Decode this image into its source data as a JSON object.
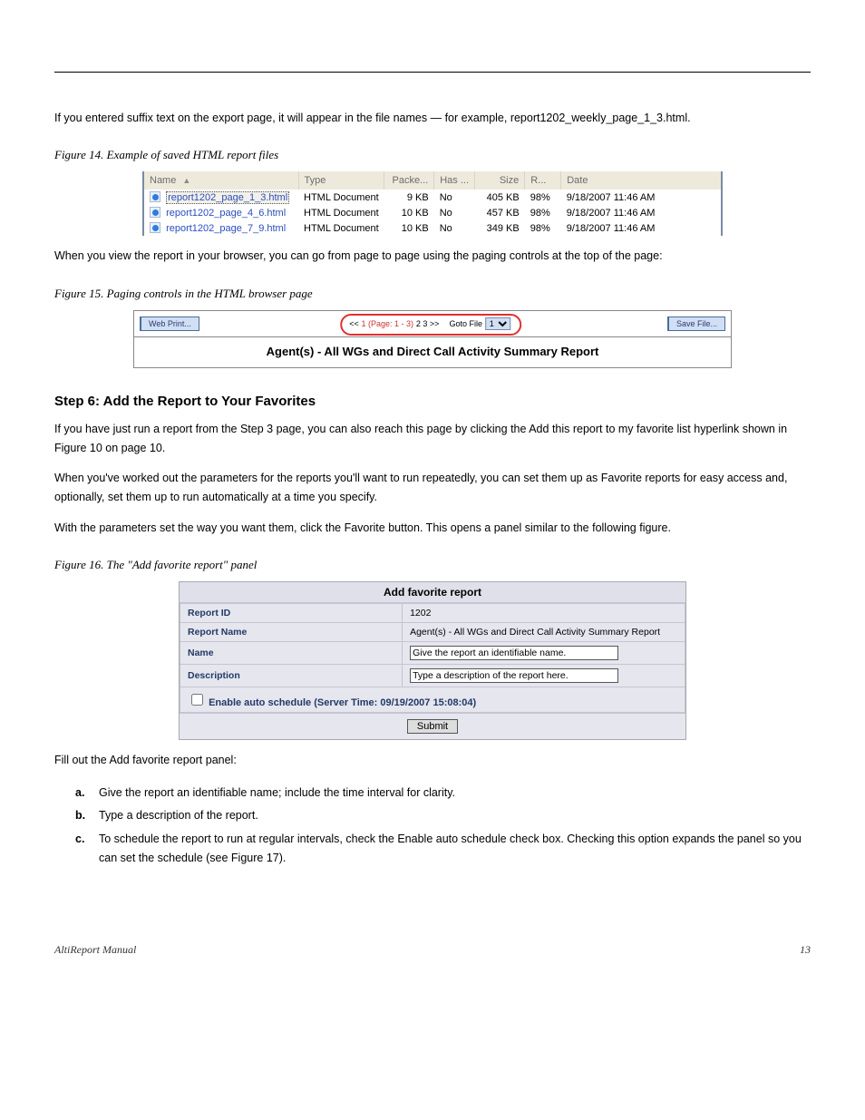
{
  "header_spacer": "",
  "para_intro": "If you entered suffix text on the export page, it will appear in the file names — for example, report1202_weekly_page_1_3.html.",
  "figure14_label": "Figure 14. Example of saved HTML report files",
  "file_table": {
    "headers": [
      "Name",
      "Type",
      "Packe...",
      "Has ...",
      "Size",
      "R...",
      "Date"
    ],
    "rows": [
      {
        "name": "report1202_page_1_3.html",
        "type": "HTML Document",
        "packe": "9 KB",
        "has": "No",
        "size": "405 KB",
        "r": "98%",
        "date": "9/18/2007 11:46 AM",
        "selected": true
      },
      {
        "name": "report1202_page_4_6.html",
        "type": "HTML Document",
        "packe": "10 KB",
        "has": "No",
        "size": "457 KB",
        "r": "98%",
        "date": "9/18/2007 11:46 AM",
        "selected": false
      },
      {
        "name": "report1202_page_7_9.html",
        "type": "HTML Document",
        "packe": "10 KB",
        "has": "No",
        "size": "349 KB",
        "r": "98%",
        "date": "9/18/2007 11:46 AM",
        "selected": false
      }
    ]
  },
  "para_view_intro": "When you view the report in your browser, you can go from page to page using the paging controls at the top of the page:",
  "figure15_label": "Figure 15. Paging controls in the HTML browser page",
  "toolbar": {
    "web_print": "Web Print...",
    "save_file": "Save File...",
    "pager_prefix": "<<",
    "pager_current": "1 (Page: 1 - 3)",
    "pager_rest": "2  3  >>",
    "goto_label": "Goto File",
    "goto_value": "1",
    "report_title": "Agent(s) - All WGs and Direct Call Activity Summary Report"
  },
  "heading_favorite": "Step 6: Add the Report to Your Favorites",
  "para_fav_1": "If you have just run a report from the Step 3 page, you can also reach this page by clicking the Add this report to my favorite list hyperlink shown in Figure 10 on page 10.",
  "para_fav_2": "When you've worked out the parameters for the reports you'll want to run repeatedly, you can set them up as Favorite reports for easy access and, optionally, set them up to run automatically at a time you specify.",
  "para_fav_3": "With the parameters set the way you want them, click the Favorite button. This opens a panel similar to the following figure.",
  "figure16_label": "Figure 16. The \"Add favorite report\" panel",
  "fav": {
    "title": "Add favorite report",
    "rows": {
      "report_id_label": "Report ID",
      "report_id_value": "1202",
      "report_name_label": "Report Name",
      "report_name_value": "Agent(s) - All WGs and Direct Call Activity Summary Report",
      "name_label": "Name",
      "name_input": "Give the report an identifiable name.",
      "desc_label": "Description",
      "desc_input": "Type a description of the report here.",
      "sched_label": "Enable auto schedule (Server Time: 09/19/2007 15:08:04)",
      "submit": "Submit"
    }
  },
  "para_fill_fav": "Fill out the Add favorite report panel:",
  "step_a_label": "a.",
  "step_a_text": "Give the report an identifiable name; include the time interval for clarity.",
  "step_b_label": "b.",
  "step_b_text": "Type a description of the report.",
  "step_c_label": "c.",
  "step_c_text": "To schedule the report to run at regular intervals, check the Enable auto schedule check box. Checking this option expands the panel so you can set the schedule (see Figure 17).",
  "footer_left": "AltiReport Manual",
  "footer_right": "13"
}
